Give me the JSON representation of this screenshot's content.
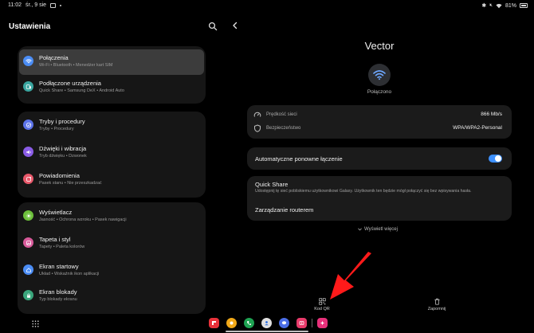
{
  "status_bar": {
    "time": "11:02",
    "date": "śr., 9 sie",
    "battery": "81%"
  },
  "left_panel": {
    "title": "Ustawienia",
    "groups": [
      {
        "items": [
          {
            "title": "Połączenia",
            "subtitle": "Wi-Fi  •  Bluetooth  •  Menedżer kart SIM",
            "icon": "wifi-icon",
            "color": "#4b8df5",
            "selected": true
          },
          {
            "title": "Podłączone urządzenia",
            "subtitle": "Quick Share  •  Samsung DeX  •  Android Auto",
            "icon": "devices-icon",
            "color": "#3aa6a0",
            "selected": false
          }
        ]
      },
      {
        "items": [
          {
            "title": "Tryby i procedury",
            "subtitle": "Tryby  •  Procedury",
            "icon": "modes-icon",
            "color": "#5b72e8",
            "selected": false
          },
          {
            "title": "Dźwięki i wibracja",
            "subtitle": "Tryb dźwięku  •  Dzwonek",
            "icon": "sound-icon",
            "color": "#8a5ce6",
            "selected": false
          },
          {
            "title": "Powiadomienia",
            "subtitle": "Pasek stanu  •  Nie przeszkadzać",
            "icon": "notification-icon",
            "color": "#e8586a",
            "selected": false
          }
        ]
      },
      {
        "items": [
          {
            "title": "Wyświetlacz",
            "subtitle": "Jasność  •  Ochrona wzroku  •  Pasek nawigacji",
            "icon": "display-icon",
            "color": "#6cbf3a",
            "selected": false
          },
          {
            "title": "Tapeta i styl",
            "subtitle": "Tapety  •  Paleta kolorów",
            "icon": "wallpaper-icon",
            "color": "#d85a9a",
            "selected": false
          },
          {
            "title": "Ekran startowy",
            "subtitle": "Układ  •  Wskaźnik ikon aplikacji",
            "icon": "home-screen-icon",
            "color": "#4b8df5",
            "selected": false
          },
          {
            "title": "Ekran blokady",
            "subtitle": "Typ blokady ekranu",
            "icon": "lock-icon",
            "color": "#3aa67c",
            "selected": false
          }
        ]
      }
    ]
  },
  "network": {
    "name": "Vector",
    "status": "Połączono",
    "speed_label": "Prędkość sieci",
    "speed_value": "866 Mb/s",
    "security_label": "Bezpieczeństwo",
    "security_value": "WPA/WPA2-Personal",
    "auto_reconnect_label": "Automatyczne ponowne łączenie",
    "auto_reconnect_on": true,
    "quick_share_title": "Quick Share",
    "quick_share_desc": "Udostępnij tę sieć pobliskiemu użytkownikowi Galaxy. Użytkownik ten będzie mógł połączyć się bez wpisywania hasła.",
    "router_label": "Zarządzanie routerem",
    "show_more": "Wyświetl więcej",
    "qr_label": "Kod QR",
    "forget_label": "Zapomnij"
  },
  "colors": {
    "accent": "#3e91ff",
    "arrow": "#ff1a1a"
  },
  "dock": [
    {
      "name": "flipboard-app-icon",
      "color": "#e8313a"
    },
    {
      "name": "gallery-app-icon",
      "color": "#f0a818"
    },
    {
      "name": "phone-app-icon",
      "color": "#1ea352"
    },
    {
      "name": "contacts-app-icon",
      "color": "#e0e0e0"
    },
    {
      "name": "messages-app-icon",
      "color": "#4b6ee8"
    },
    {
      "name": "screen-recorder-app-icon",
      "color": "#e83a6a"
    },
    {
      "name": "bixby-routines-app-icon",
      "color": "#e8307a"
    }
  ]
}
